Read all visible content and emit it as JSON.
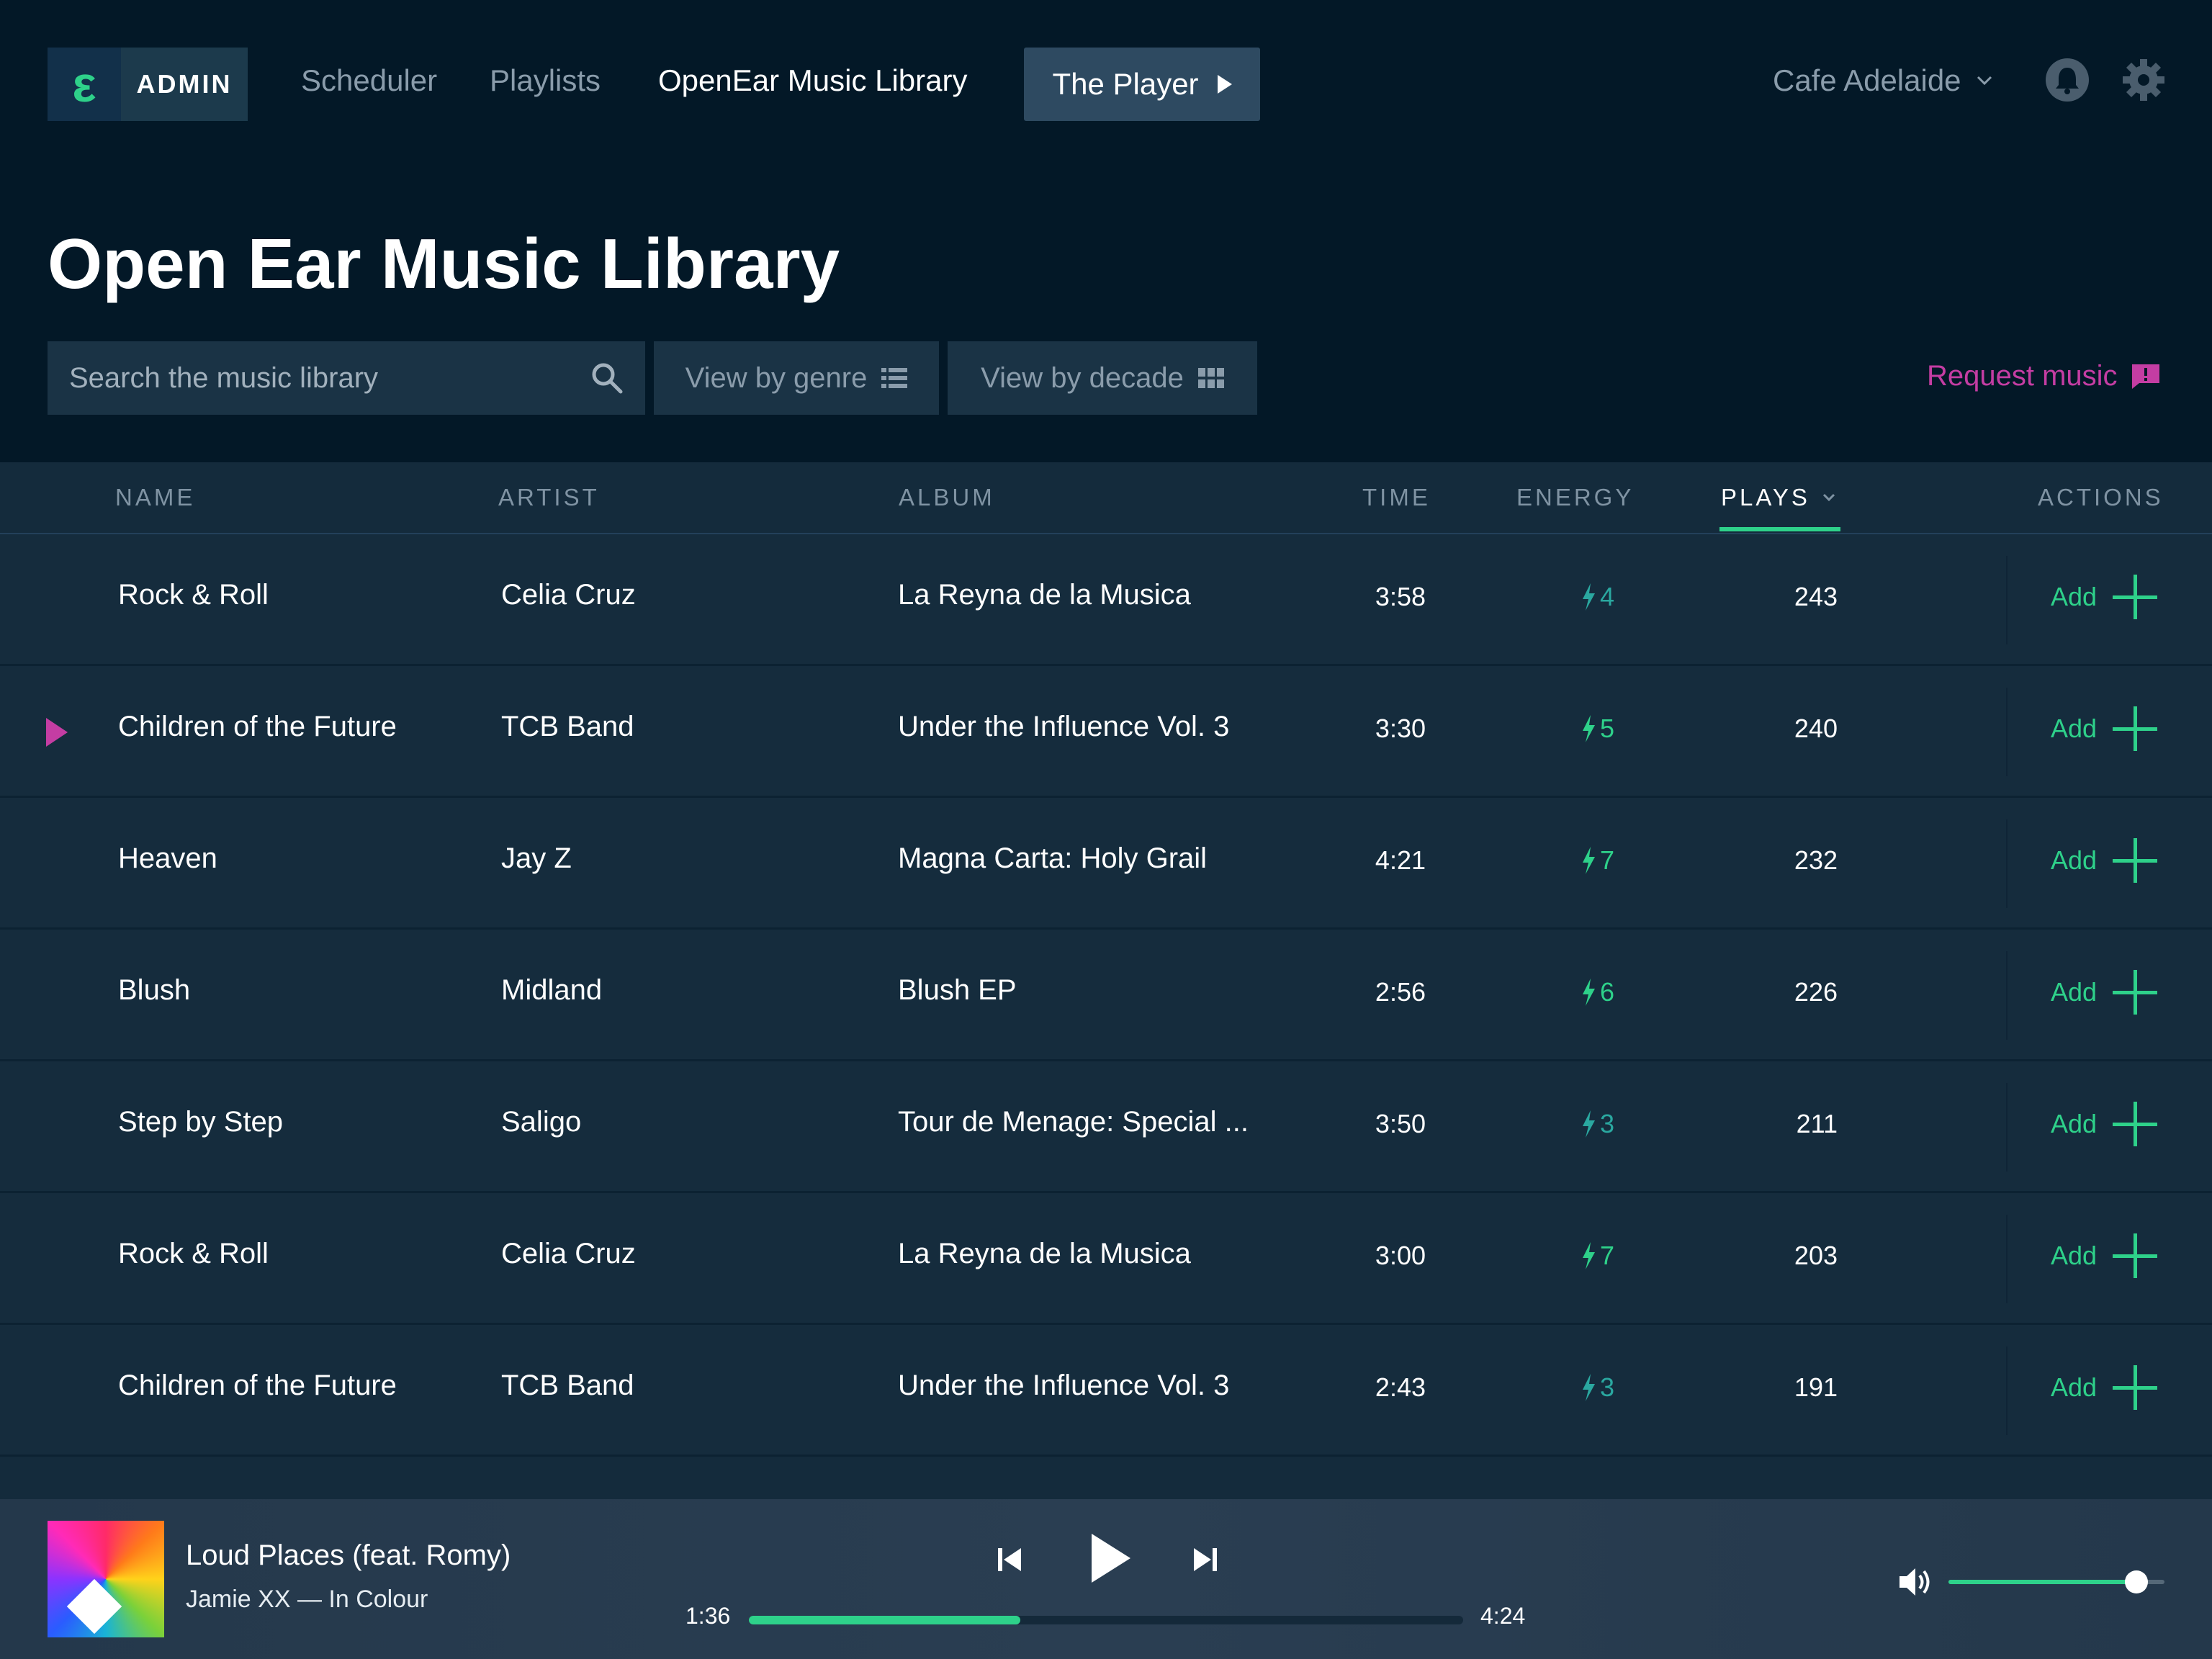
{
  "nav": {
    "logo_glyph": "ε",
    "admin_label": "ADMIN",
    "links": [
      "Scheduler",
      "Playlists",
      "OpenEar Music Library"
    ],
    "player_button": "The Player",
    "venue": "Cafe Adelaide",
    "bell_icon": "bell-icon",
    "settings_icon": "gear-icon"
  },
  "page": {
    "title": "Open Ear Music Library",
    "search_placeholder": "Search the music library",
    "view_genre": "View by genre",
    "view_decade": "View by decade",
    "request_music": "Request music"
  },
  "table": {
    "headers": {
      "name": "NAME",
      "artist": "ARTIST",
      "album": "ALBUM",
      "time": "TIME",
      "energy": "ENERGY",
      "plays": "PLAYS",
      "actions": "ACTIONS"
    },
    "sorted_by": "plays",
    "add_label": "Add",
    "rows": [
      {
        "name": "Rock & Roll",
        "artist": "Celia Cruz",
        "album": "La Reyna de la Musica",
        "time": "3:58",
        "energy": "4",
        "plays": "243",
        "playing": false
      },
      {
        "name": "Children of the Future",
        "artist": "TCB Band",
        "album": "Under the Influence Vol. 3",
        "time": "3:30",
        "energy": "5",
        "plays": "240",
        "playing": true
      },
      {
        "name": "Heaven",
        "artist": "Jay Z",
        "album": "Magna Carta: Holy Grail",
        "time": "4:21",
        "energy": "7",
        "plays": "232",
        "playing": false
      },
      {
        "name": "Blush",
        "artist": "Midland",
        "album": "Blush EP",
        "time": "2:56",
        "energy": "6",
        "plays": "226",
        "playing": false
      },
      {
        "name": "Step by Step",
        "artist": "Saligo",
        "album": "Tour de Menage: Special ...",
        "time": "3:50",
        "energy": "3",
        "plays": "211",
        "playing": false
      },
      {
        "name": "Rock & Roll",
        "artist": "Celia Cruz",
        "album": "La Reyna de la Musica",
        "time": "3:00",
        "energy": "7",
        "plays": "203",
        "playing": false
      },
      {
        "name": "Children of the Future",
        "artist": "TCB Band",
        "album": "Under the Influence Vol. 3",
        "time": "2:43",
        "energy": "3",
        "plays": "191",
        "playing": false
      }
    ]
  },
  "player": {
    "track": "Loud Places (feat. Romy)",
    "subtitle": "Jamie XX — In Colour",
    "elapsed": "1:36",
    "total": "4:24",
    "progress": 0.38,
    "volume": 0.87
  },
  "colors": {
    "accent_green": "#2ed18a",
    "accent_magenta": "#c43da3",
    "energy_low": "#2aa8a0",
    "energy_high": "#2ed18a"
  }
}
